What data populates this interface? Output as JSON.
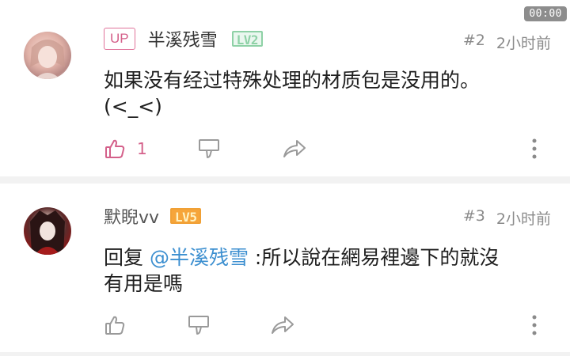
{
  "timer": "00:00",
  "comments": [
    {
      "badge": "UP",
      "username": "半溪残雪",
      "level": "LV2",
      "floor": "#2",
      "time": "2小时前",
      "text_line1": "如果没有经过特殊处理的材质包是没用的。",
      "text_line2": "(<_<)",
      "likes": "1",
      "icons": {
        "like": "thumb-up-icon",
        "dislike": "thumb-down-icon",
        "share": "share-icon",
        "more": "more-vertical-icon"
      }
    },
    {
      "username": "默睨vv",
      "level": "LV5",
      "floor": "#3",
      "time": "2小时前",
      "reply_prefix": "回复 ",
      "mention": "@半溪残雪",
      "text_rest": " :所以說在網易裡邊下的就沒",
      "text_line2": "有用是嗎",
      "icons": {
        "like": "thumb-up-icon",
        "dislike": "thumb-down-icon",
        "share": "share-icon",
        "more": "more-vertical-icon"
      }
    }
  ],
  "colors": {
    "accent_pink": "#d4608a",
    "mention_blue": "#3c8fd0",
    "level2": "#8ed1a6",
    "level5": "#f6a53a"
  }
}
